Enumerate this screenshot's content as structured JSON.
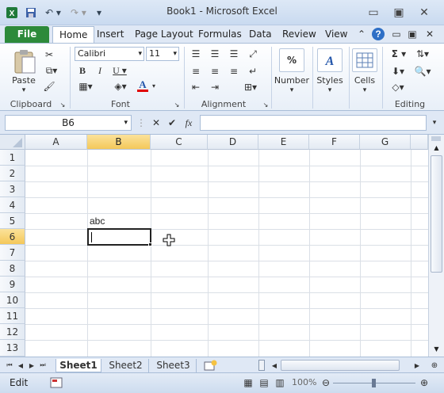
{
  "window": {
    "title": "Book1  -  Microsoft Excel"
  },
  "qat": {
    "save_icon": "save-icon",
    "undo_icon": "undo-icon",
    "redo_icon": "redo-icon"
  },
  "tabs": [
    {
      "label": "File"
    },
    {
      "label": "Home"
    },
    {
      "label": "Insert"
    },
    {
      "label": "Page Layout"
    },
    {
      "label": "Formulas"
    },
    {
      "label": "Data"
    },
    {
      "label": "Review"
    },
    {
      "label": "View"
    }
  ],
  "ribbon": {
    "clipboard": {
      "paste_label": "Paste",
      "group_label": "Clipboard"
    },
    "font": {
      "font_name": "Calibri",
      "font_size": "11",
      "group_label": "Font"
    },
    "alignment": {
      "group_label": "Alignment"
    },
    "number": {
      "label": "Number"
    },
    "styles": {
      "label": "Styles"
    },
    "cells": {
      "label": "Cells"
    },
    "editing": {
      "group_label": "Editing"
    }
  },
  "formula_bar": {
    "name_box": "B6",
    "fx": "fx",
    "value": ""
  },
  "columns": [
    "A",
    "B",
    "C",
    "D",
    "E",
    "F",
    "G"
  ],
  "rows": [
    "1",
    "2",
    "3",
    "4",
    "5",
    "6",
    "7",
    "8",
    "9",
    "10",
    "11",
    "12",
    "13"
  ],
  "cells": {
    "B5": "abc"
  },
  "sheets": [
    {
      "label": "Sheet1"
    },
    {
      "label": "Sheet2"
    },
    {
      "label": "Sheet3"
    }
  ],
  "status": {
    "mode": "Edit",
    "zoom": "100%"
  },
  "colors": {
    "file_tab": "#2d8a3a",
    "selection_header": "#f4c85a",
    "font_color_bar": "#e00000"
  }
}
